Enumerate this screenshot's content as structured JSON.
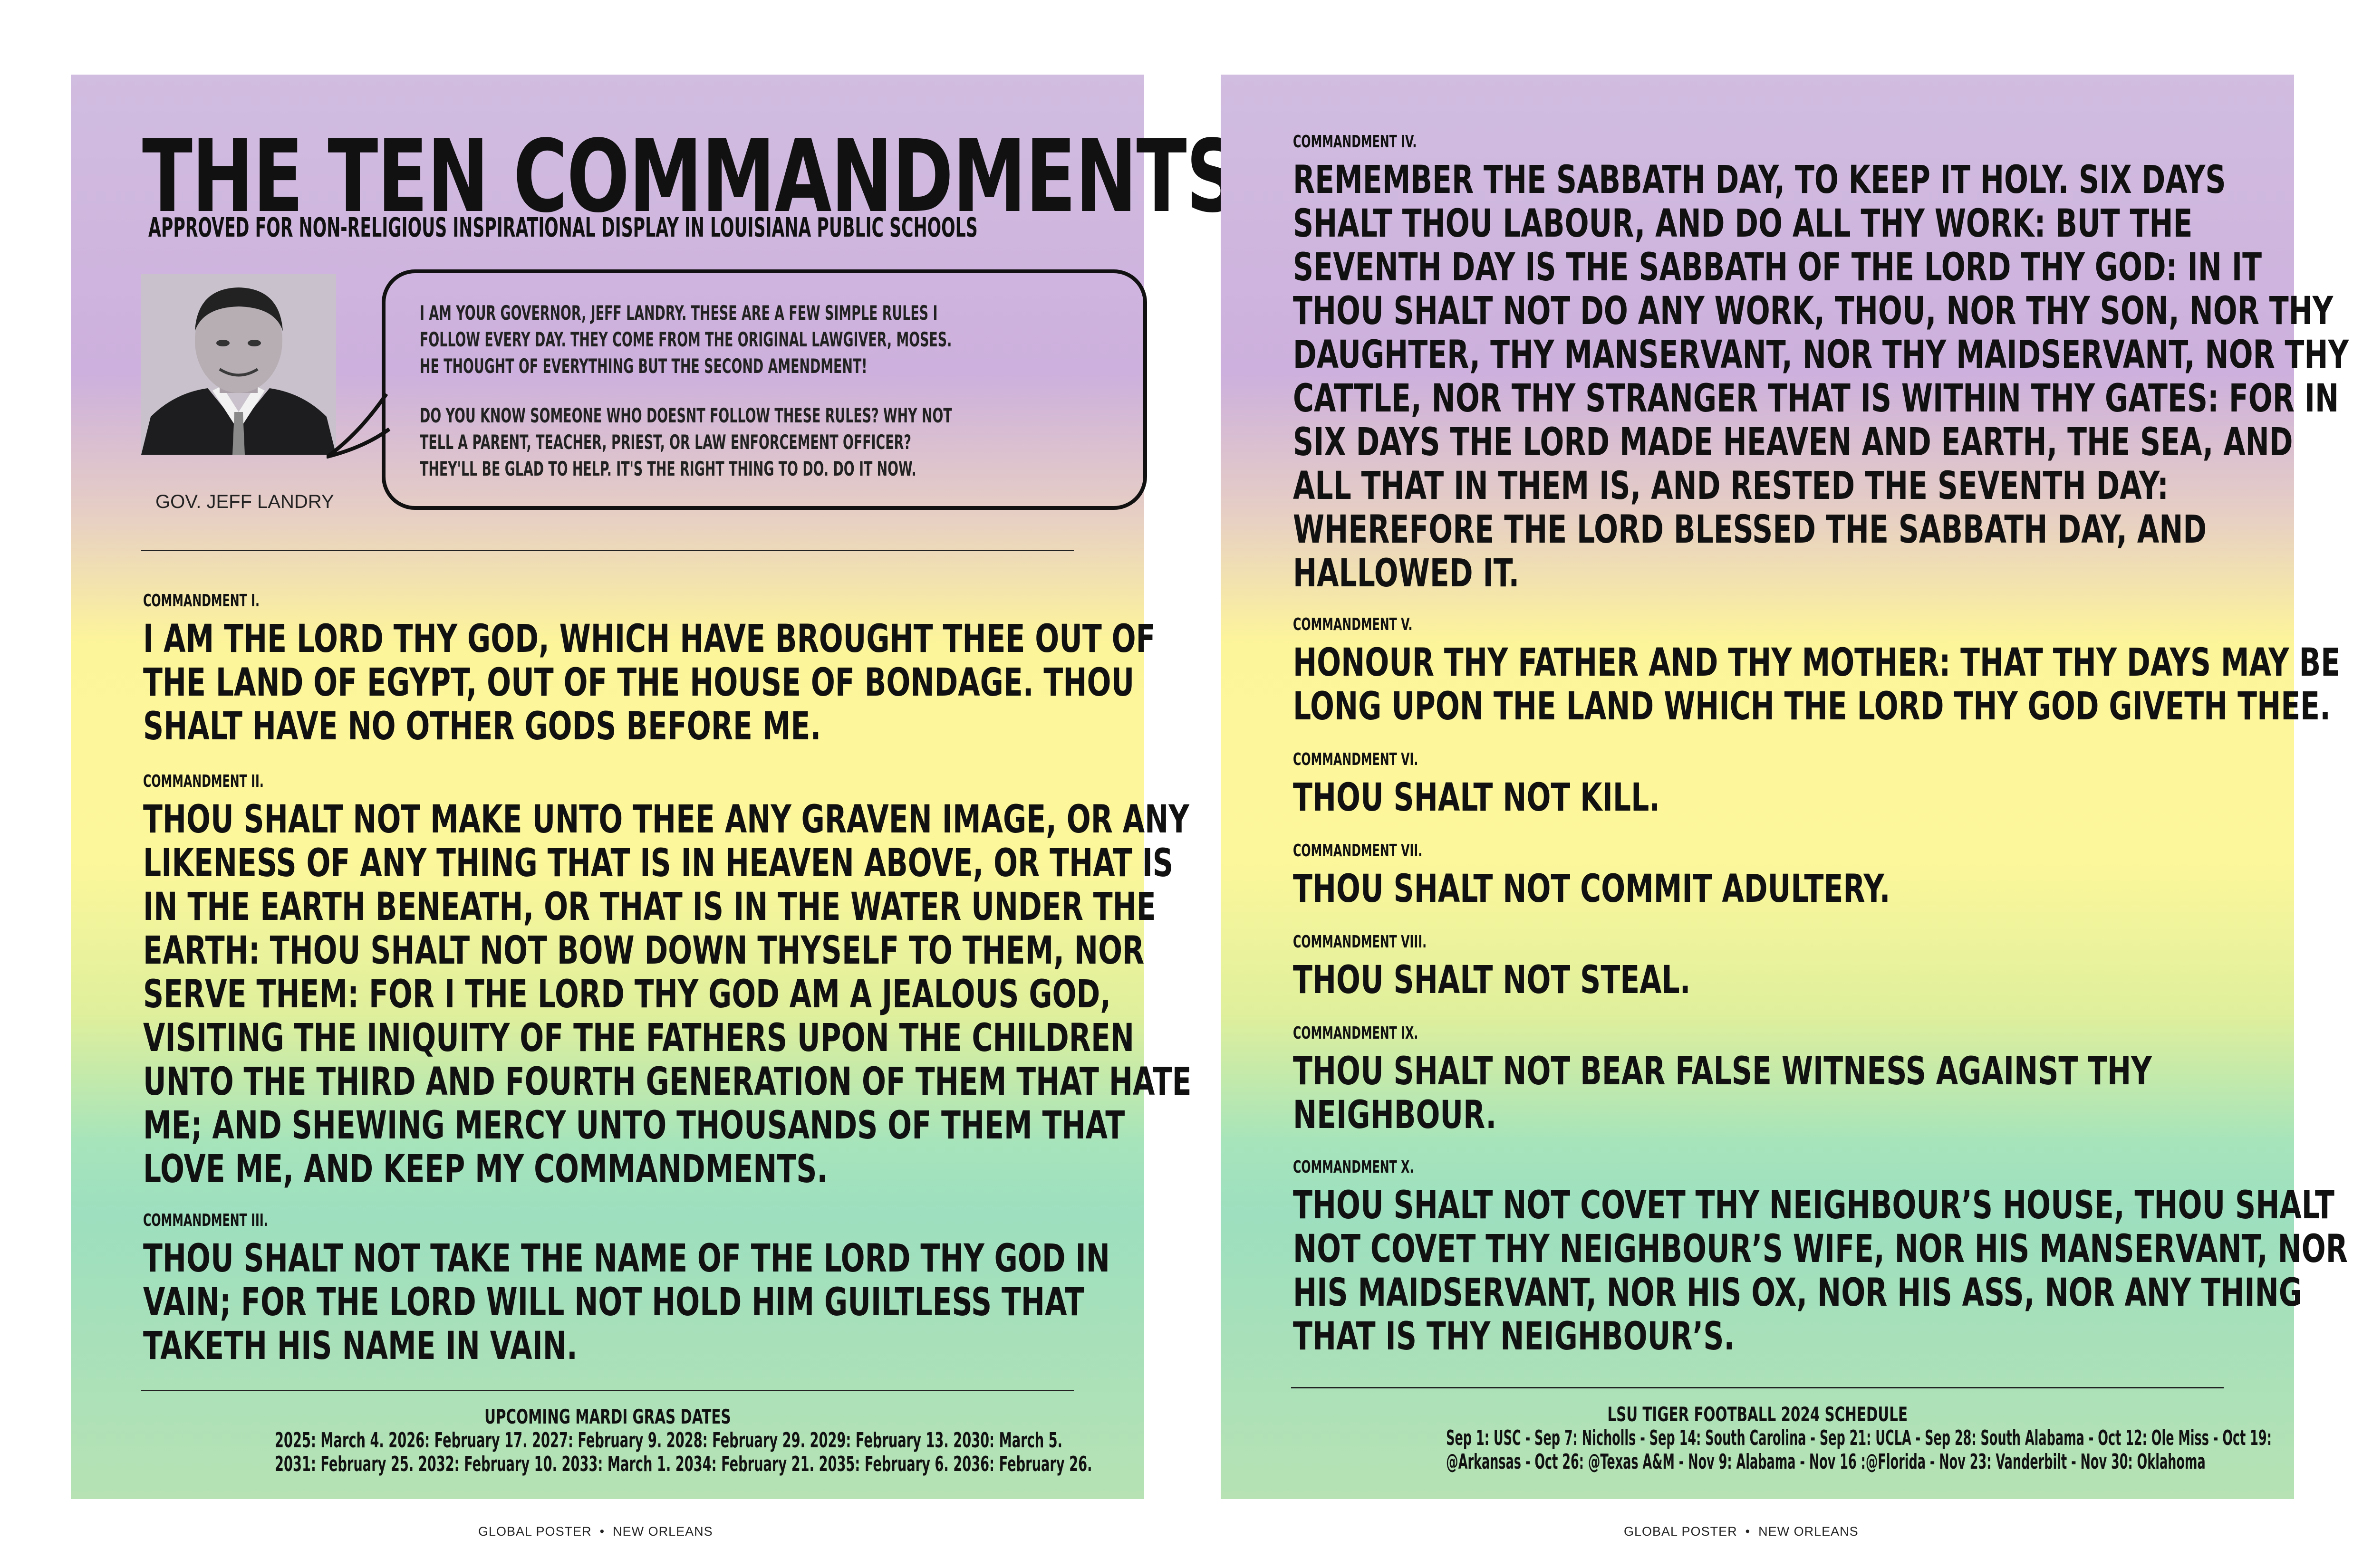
{
  "left": {
    "title": "THE TEN COMMANDMENTS",
    "subtitle": "APPROVED FOR NON-RELIGIOUS INSPIRATIONAL DISPLAY IN LOUISIANA PUBLIC SCHOOLS",
    "portrait_caption": "GOV. JEFF LANDRY",
    "bubble_p1": "I AM YOUR GOVERNOR, JEFF LANDRY. THESE ARE A FEW SIMPLE RULES I\nFOLLOW EVERY DAY. THEY COME FROM THE ORIGINAL LAWGIVER, MOSES.\nHE THOUGHT OF EVERYTHING BUT THE SECOND AMENDMENT!",
    "bubble_p2": "DO YOU KNOW SOMEONE WHO DOESNT FOLLOW THESE RULES? WHY NOT\nTELL A PARENT, TEACHER, PRIEST, OR LAW ENFORCEMENT OFFICER?\nTHEY'LL BE GLAD TO HELP. IT'S THE RIGHT THING TO DO. DO IT NOW.",
    "commandments": [
      {
        "label": "COMMANDMENT I.",
        "text": "I AM THE LORD THY GOD, WHICH HAVE BROUGHT THEE OUT OF\nTHE LAND OF EGYPT, OUT OF THE HOUSE OF BONDAGE. THOU\nSHALT HAVE NO OTHER GODS BEFORE ME."
      },
      {
        "label": "COMMANDMENT II.",
        "text": "THOU SHALT NOT MAKE UNTO THEE ANY GRAVEN IMAGE, OR ANY\nLIKENESS OF ANY THING THAT IS IN HEAVEN ABOVE, OR THAT IS\nIN THE EARTH BENEATH, OR THAT IS IN THE WATER UNDER THE\nEARTH: THOU SHALT NOT BOW DOWN THYSELF TO THEM, NOR\nSERVE THEM: FOR I THE LORD THY GOD AM A JEALOUS GOD,\nVISITING THE INIQUITY OF THE FATHERS UPON THE CHILDREN\nUNTO THE THIRD AND FOURTH GENERATION OF THEM THAT HATE\nME; AND SHEWING MERCY UNTO THOUSANDS OF THEM THAT\nLOVE ME, AND KEEP MY COMMANDMENTS."
      },
      {
        "label": "COMMANDMENT III.",
        "text": "THOU SHALT NOT TAKE THE NAME OF THE LORD THY GOD IN\nVAIN; FOR THE LORD WILL NOT HOLD HIM GUILTLESS THAT\nTAKETH HIS NAME IN VAIN."
      }
    ],
    "footer_title": "UPCOMING MARDI GRAS DATES",
    "footer_line1": "2025: March 4.  2026: February 17.  2027: February 9.  2028: February 29.  2029: February 13.  2030: March 5.",
    "footer_line2": "2031: February 25.  2032: February 10.  2033: March 1.  2034: February 21.  2035: February 6.  2036: February 26.",
    "credit_left": "GLOBAL POSTER",
    "credit_right": "NEW ORLEANS"
  },
  "right": {
    "commandments": [
      {
        "label": "COMMANDMENT IV.",
        "text": "REMEMBER THE SABBATH DAY, TO KEEP IT HOLY. SIX DAYS\nSHALT THOU LABOUR, AND DO ALL THY WORK: BUT THE\nSEVENTH DAY IS THE SABBATH OF THE LORD THY GOD: IN IT\nTHOU SHALT NOT DO ANY WORK, THOU, NOR THY SON, NOR THY\nDAUGHTER, THY MANSERVANT, NOR THY MAIDSERVANT, NOR THY\nCATTLE, NOR THY STRANGER THAT IS WITHIN THY GATES: FOR IN\nSIX DAYS THE LORD MADE HEAVEN AND EARTH, THE SEA, AND\nALL THAT IN THEM IS, AND RESTED THE SEVENTH DAY:\nWHEREFORE THE LORD BLESSED THE SABBATH DAY, AND\nHALLOWED IT."
      },
      {
        "label": "COMMANDMENT V.",
        "text": "HONOUR THY FATHER AND THY MOTHER: THAT THY DAYS MAY BE\nLONG UPON THE LAND WHICH THE LORD THY GOD GIVETH THEE."
      },
      {
        "label": "COMMANDMENT VI.",
        "text": "THOU SHALT NOT KILL."
      },
      {
        "label": "COMMANDMENT VII.",
        "text": "THOU SHALT NOT COMMIT ADULTERY."
      },
      {
        "label": "COMMANDMENT VIII.",
        "text": "THOU SHALT NOT STEAL."
      },
      {
        "label": "COMMANDMENT IX.",
        "text": "THOU SHALT NOT BEAR FALSE WITNESS AGAINST THY\nNEIGHBOUR."
      },
      {
        "label": "COMMANDMENT X.",
        "text": "THOU SHALT NOT COVET THY NEIGHBOUR’S HOUSE, THOU SHALT\nNOT COVET THY NEIGHBOUR’S WIFE, NOR HIS MANSERVANT, NOR\nHIS MAIDSERVANT, NOR HIS OX, NOR HIS ASS, NOR ANY THING\nTHAT IS THY NEIGHBOUR’S."
      }
    ],
    "footer_title": "LSU TIGER FOOTBALL 2024 SCHEDULE",
    "footer_line1": "Sep 1: USC - Sep 7: Nicholls - Sep 14: South Carolina - Sep 21: UCLA  - Sep 28: South Alabama - Oct 12: Ole Miss - Oct 19:",
    "footer_line2": "@Arkansas - Oct 26: @Texas A&M - Nov 9:  Alabama - Nov 16 :@Florida - Nov 23: Vanderbilt  - Nov 30:  Oklahoma",
    "credit_left": "GLOBAL POSTER",
    "credit_right": "NEW ORLEANS"
  }
}
